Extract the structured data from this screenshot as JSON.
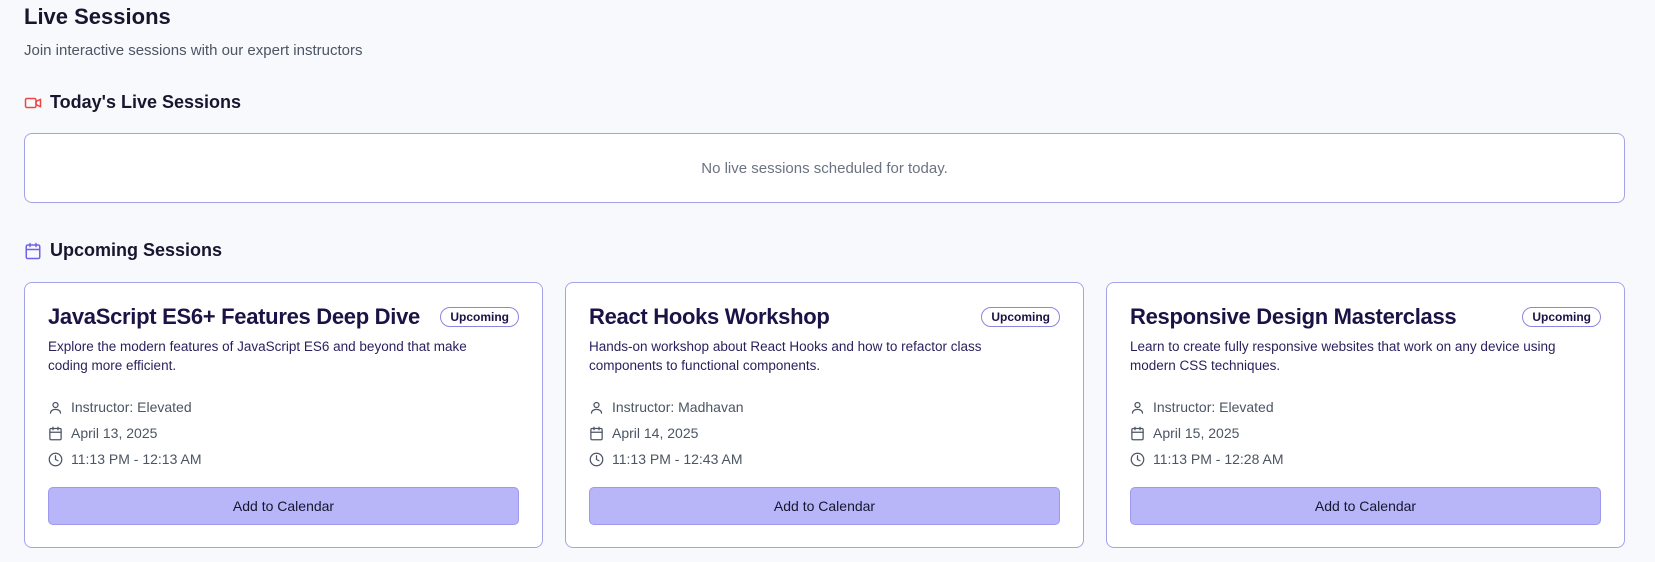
{
  "header": {
    "title": "Live Sessions",
    "subtitle": "Join interactive sessions with our expert instructors"
  },
  "today": {
    "title": "Today's Live Sessions",
    "icon": "video-camera-icon",
    "empty_message": "No live sessions scheduled for today."
  },
  "upcoming": {
    "title": "Upcoming Sessions",
    "icon": "calendar-icon",
    "sessions": [
      {
        "title": "JavaScript ES6+ Features Deep Dive",
        "badge": "Upcoming",
        "description": "Explore the modern features of JavaScript ES6 and beyond that make coding more efficient.",
        "instructor": "Instructor: Elevated",
        "date": "April 13, 2025",
        "time": "11:13 PM - 12:13 AM",
        "button": "Add to Calendar"
      },
      {
        "title": "React Hooks Workshop",
        "badge": "Upcoming",
        "description": "Hands-on workshop about React Hooks and how to refactor class components to functional components.",
        "instructor": "Instructor: Madhavan",
        "date": "April 14, 2025",
        "time": "11:13 PM - 12:43 AM",
        "button": "Add to Calendar"
      },
      {
        "title": "Responsive Design Masterclass",
        "badge": "Upcoming",
        "description": "Learn to create fully responsive websites that work on any device using modern CSS techniques.",
        "instructor": "Instructor: Elevated",
        "date": "April 15, 2025",
        "time": "11:13 PM - 12:28 AM",
        "button": "Add to Calendar"
      }
    ]
  },
  "colors": {
    "accent": "#b8b5f9",
    "border": "#a5a3e8",
    "video_icon": "#ef4444",
    "calendar_icon": "#6d63e8"
  }
}
